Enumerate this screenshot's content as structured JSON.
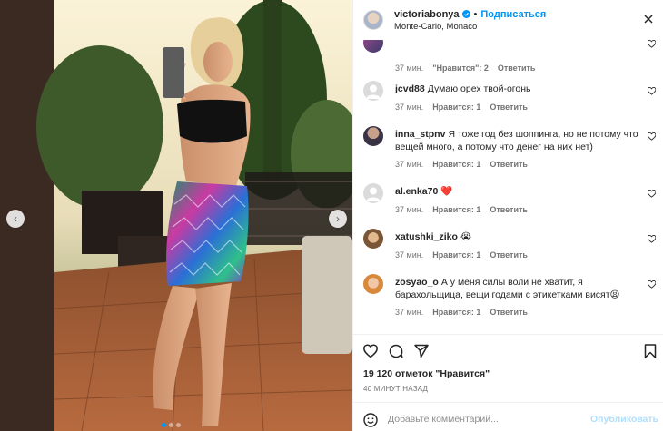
{
  "header": {
    "username": "victoriabonya",
    "separator": "•",
    "follow_label": "Подписаться",
    "location": "Monte-Carlo, Monaco"
  },
  "comments": [
    {
      "user": "",
      "text": "",
      "time": "37 мин.",
      "likes": "\"Нравится\": 2",
      "reply": "Ответить",
      "partial": true
    },
    {
      "user": "jcvd88",
      "text": "Думаю орех твой-огонь",
      "time": "37 мин.",
      "likes": "Нравится: 1",
      "reply": "Ответить"
    },
    {
      "user": "inna_stpnv",
      "text": "Я тоже год без шоппинга, но не потому что вещей много, а потому что денег на них нет)",
      "time": "37 мин.",
      "likes": "Нравится: 1",
      "reply": "Ответить"
    },
    {
      "user": "al.enka70",
      "text": "❤️",
      "time": "37 мин.",
      "likes": "Нравится: 1",
      "reply": "Ответить"
    },
    {
      "user": "xatushki_ziko",
      "text": "😭",
      "time": "37 мин.",
      "likes": "Нравится: 1",
      "reply": "Ответить"
    },
    {
      "user": "zosyao_o",
      "text": "А у меня силы воли не хватит, я барахольщица, вещи годами с этикетками висят😫",
      "time": "37 мин.",
      "likes": "Нравится: 1",
      "reply": "Ответить"
    }
  ],
  "likes_count": "19 120 отметок \"Нравится\"",
  "posted_time": "40 минут назад",
  "add_comment": {
    "placeholder": "Добавьте комментарий...",
    "publish_label": "Опубликовать"
  },
  "icons": {
    "verified": "verified-badge-icon",
    "more": "more-options-icon",
    "like": "heart-icon",
    "comment": "comment-bubble-icon",
    "share": "paper-plane-icon",
    "save": "bookmark-icon",
    "emoji": "emoji-smile-icon"
  },
  "colors": {
    "accent": "#0095f6",
    "text": "#262626",
    "muted": "#737373",
    "heart_red": "#ed4956"
  }
}
